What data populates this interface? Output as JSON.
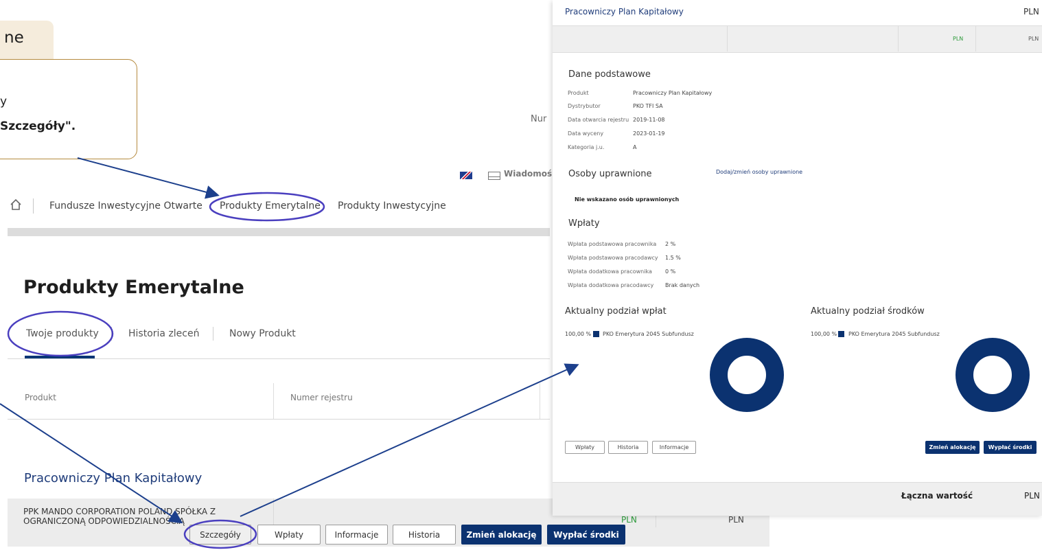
{
  "callout": {
    "tab_text": "ne",
    "line1": "y",
    "line2": "Szczegóły\"."
  },
  "header": {
    "nr_text": "Nur",
    "messages": "Wiadomoś"
  },
  "nav": {
    "items": [
      "Fundusze Inwestycyjne Otwarte",
      "Produkty Emerytalne",
      "Produkty Inwestycyjne"
    ]
  },
  "page": {
    "title": "Produkty Emerytalne",
    "tabs": [
      "Twoje produkty",
      "Historia zleceń",
      "Nowy Produkt"
    ],
    "table_headers": [
      "Produkt",
      "Numer rejestru"
    ],
    "section_title": "Pracowniczy Plan Kapitałowy",
    "row": {
      "name": "PPK MANDO CORPORATION POLAND SPÓŁKA Z OGRANICZONĄ ODPOWIEDZIALNOŚCIĄ",
      "pln1": "PLN",
      "pln2": "PLN"
    },
    "buttons": [
      "Szczegóły",
      "Wpłaty",
      "Informacje",
      "Historia",
      "Zmień alokację",
      "Wypłać środki"
    ]
  },
  "panel": {
    "title": "Pracowniczy Plan Kapitałowy",
    "head_currency": "PLN",
    "bar_pln1": "PLN",
    "bar_pln2": "PLN",
    "basic": {
      "title": "Dane podstawowe",
      "rows": [
        {
          "k": "Produkt",
          "v": "Pracowniczy Plan Kapitałowy"
        },
        {
          "k": "Dystrybutor",
          "v": "PKO TFI SA"
        },
        {
          "k": "Data otwarcia rejestru",
          "v": "2019-11-08"
        },
        {
          "k": "Data wyceny",
          "v": "2023-01-19"
        },
        {
          "k": "Kategoria j.u.",
          "v": "A"
        }
      ]
    },
    "persons": {
      "title": "Osoby uprawnione",
      "link": "Dodaj/zmień osoby uprawnione",
      "empty": "Nie wskazano osób uprawnionych"
    },
    "payments": {
      "title": "Wpłaty",
      "rows": [
        {
          "k": "Wpłata podstawowa pracownika",
          "v": "2 %"
        },
        {
          "k": "Wpłata podstawowa pracodawcy",
          "v": "1.5 %"
        },
        {
          "k": "Wpłata dodatkowa pracownika",
          "v": "0 %"
        },
        {
          "k": "Wpłata dodatkowa pracodawcy",
          "v": "Brak danych"
        }
      ]
    },
    "alloc_payments": {
      "title": "Aktualny podział wpłat",
      "percent": "100,00 %",
      "fund": "PKO Emerytura 2045 Subfundusz",
      "share": 1.0
    },
    "alloc_funds": {
      "title": "Aktualny podział środków",
      "percent": "100,00 %",
      "fund": "PKO Emerytura 2045 Subfundusz",
      "share": 1.0
    },
    "buttons": [
      "Wpłaty",
      "Historia",
      "Informacje",
      "Zmień alokację",
      "Wypłać środki"
    ],
    "total_label": "Łączna wartość",
    "total_currency": "PLN"
  },
  "colors": {
    "navy": "#0b3270",
    "highlight": "#4a3fbf",
    "arrow": "#1c3f8c"
  }
}
